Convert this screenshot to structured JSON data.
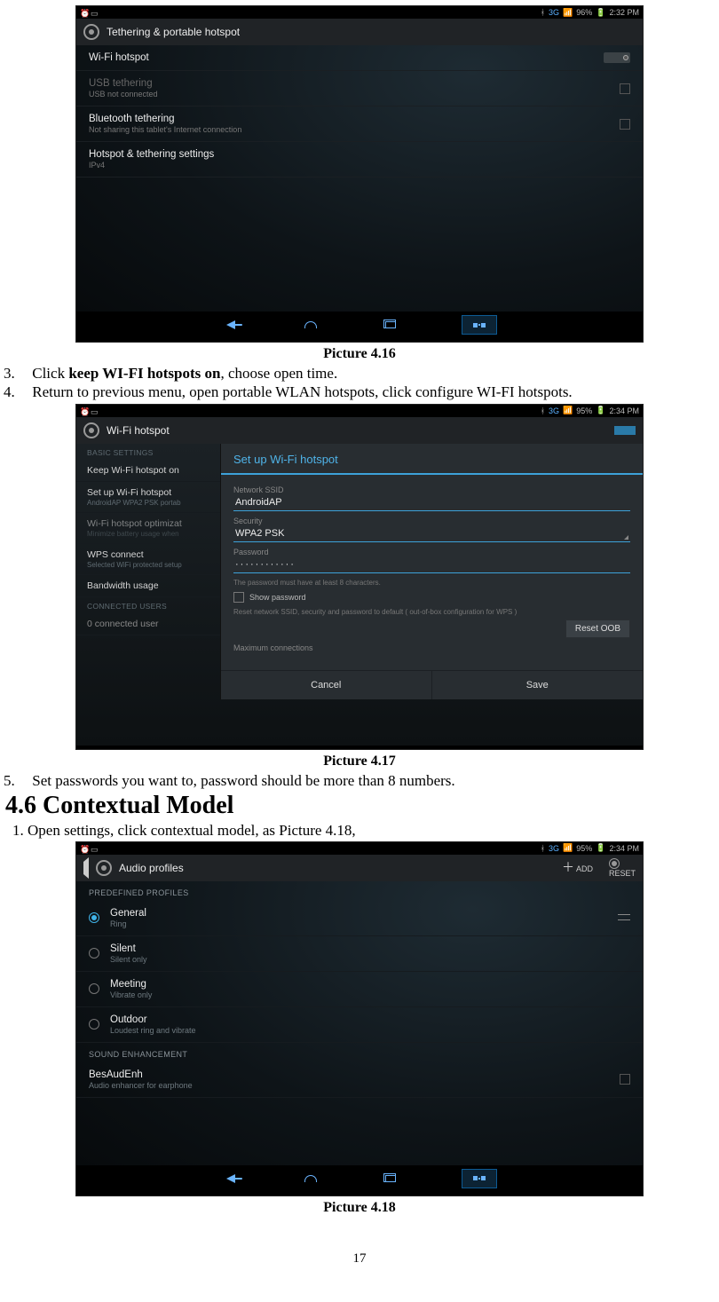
{
  "page_number": "17",
  "captions": {
    "p416": "Picture 4.16",
    "p417": "Picture 4.17",
    "p418": "Picture 4.18"
  },
  "steps": {
    "s3": {
      "num": "3.",
      "prefix": "Click ",
      "bold": "keep WI-FI hotspots on",
      "suffix": ", choose open time."
    },
    "s4": {
      "num": "4.",
      "text": "Return to previous menu, open portable WLAN hotspots, click configure WI-FI hotspots."
    },
    "s5": {
      "num": "5.",
      "text": "Set passwords you want to, password should be more than 8 numbers."
    }
  },
  "section_head": "4.6 Contextual Model",
  "context_para": "1. Open settings, click contextual model, as Picture 4.18,",
  "status": {
    "net3g": "3G",
    "batt96": "96%",
    "batt95": "95%",
    "time": "2:34 PM",
    "time2": "2:32 PM"
  },
  "pic416": {
    "header": "Tethering & portable hotspot",
    "rows": {
      "wifi": {
        "title": "Wi-Fi hotspot"
      },
      "usb": {
        "title": "USB tethering",
        "sub": "USB not connected"
      },
      "bt": {
        "title": "Bluetooth tethering",
        "sub": "Not sharing this tablet's Internet connection"
      },
      "hs": {
        "title": "Hotspot & tethering settings",
        "sub": "IPv4"
      }
    }
  },
  "pic417": {
    "header": "Wi-Fi hotspot",
    "side": {
      "basic": "BASIC SETTINGS",
      "keep": "Keep Wi-Fi hotspot on",
      "setup": {
        "title": "Set up Wi-Fi hotspot",
        "sub": "AndroidAP WPA2 PSK portab"
      },
      "opt": {
        "title": "Wi-Fi hotspot optimizat",
        "sub": "Minimize battery usage when"
      },
      "wps": {
        "title": "WPS connect",
        "sub": "Selected WiFi protected setup"
      },
      "bw": "Bandwidth usage",
      "conn": "CONNECTED USERS",
      "zero": "0 connected user"
    },
    "dialog": {
      "title": "Set up Wi-Fi hotspot",
      "ssid_label": "Network SSID",
      "ssid": "AndroidAP",
      "sec_label": "Security",
      "sec": "WPA2 PSK",
      "pwd_label": "Password",
      "pwd": "············",
      "pwd_note": "The password must have at least 8 characters.",
      "show_pwd": "Show password",
      "reset_note": "Reset network SSID, security and password to default ( out-of-box configuration for WPS )",
      "reset_btn": "Reset OOB",
      "max": "Maximum connections",
      "cancel": "Cancel",
      "save": "Save"
    }
  },
  "pic418": {
    "header": "Audio profiles",
    "add": "ADD",
    "reset": "RESET",
    "cat1": "PREDEFINED PROFILES",
    "cat2": "SOUND ENHANCEMENT",
    "profiles": {
      "general": {
        "title": "General",
        "sub": "Ring"
      },
      "silent": {
        "title": "Silent",
        "sub": "Silent only"
      },
      "meeting": {
        "title": "Meeting",
        "sub": "Vibrate only"
      },
      "outdoor": {
        "title": "Outdoor",
        "sub": "Loudest ring and vibrate"
      }
    },
    "bes": {
      "title": "BesAudEnh",
      "sub": "Audio enhancer for earphone"
    }
  }
}
